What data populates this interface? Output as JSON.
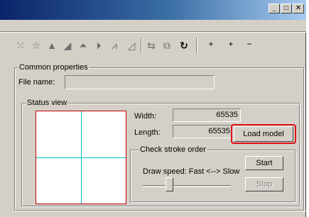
{
  "titlebar": {
    "minimize_glyph": "_",
    "maximize_glyph": "□",
    "close_glyph": "✕"
  },
  "toolbar": {
    "icons": [
      {
        "name": "select-all-icon",
        "glyph": "⁙",
        "enabled": false
      },
      {
        "name": "reset-icon",
        "glyph": "☆",
        "enabled": false
      },
      {
        "name": "lock-icon",
        "glyph": "▲",
        "enabled": false
      },
      {
        "name": "unlock-icon",
        "glyph": "◢",
        "enabled": false
      },
      {
        "name": "flip-vertical-icon",
        "glyph": "⏶",
        "enabled": false
      },
      {
        "name": "flip-horizontal-icon",
        "glyph": "⏵",
        "enabled": false
      },
      {
        "name": "mirror-icon",
        "glyph": "⩘",
        "enabled": false
      },
      {
        "name": "skew-icon",
        "glyph": "◿",
        "enabled": false
      },
      {
        "name": "swap-icon",
        "glyph": "⇆",
        "enabled": false
      },
      {
        "name": "copy-icon",
        "glyph": "⧉",
        "enabled": false
      },
      {
        "name": "rotate-icon",
        "glyph": "↻",
        "enabled": true
      },
      {
        "name": "add-point-icon",
        "glyph": "⁺",
        "enabled": true
      },
      {
        "name": "insert-point-icon",
        "glyph": "⁺",
        "enabled": true
      },
      {
        "name": "remove-point-icon",
        "glyph": "⁻",
        "enabled": true
      }
    ]
  },
  "common": {
    "title": "Common properties",
    "file_name_label": "File name:",
    "file_name_value": ""
  },
  "status": {
    "title": "Status view",
    "width_label": "Width:",
    "width_value": "65535",
    "length_label": "Length:",
    "length_value": "65535",
    "load_model_label": "Load model"
  },
  "stroke": {
    "title": "Check stroke order",
    "draw_speed_label": "Draw speed:  Fast <--> Slow",
    "start_label": "Start",
    "stop_label": "Stop",
    "speed_level_percent": 30
  },
  "colors": {
    "highlight": "#e0101a",
    "preview_border": "#c00000",
    "preview_grid": "#00c0c0"
  }
}
